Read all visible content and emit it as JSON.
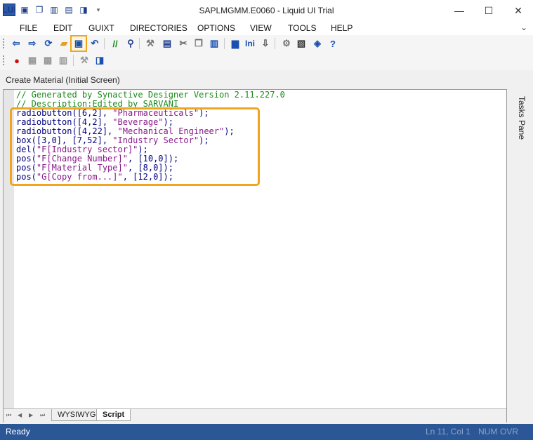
{
  "window": {
    "title": "SAPLMGMM.E0060 - Liquid UI Trial",
    "logo_text": "LUI",
    "controls": {
      "minimize": "—",
      "maximize": "☐",
      "close": "✕"
    }
  },
  "menu": {
    "items": [
      "FILE",
      "EDIT",
      "GUIXT",
      "DIRECTORIES",
      "OPTIONS",
      "VIEW",
      "TOOLS",
      "HELP"
    ],
    "collapse_glyph": "⌄"
  },
  "toolbar": {
    "buttons": [
      {
        "icon": "back-arrow-icon",
        "glyph": "⇦",
        "color": "#1a50b0"
      },
      {
        "icon": "forward-arrow-icon",
        "glyph": "⇨",
        "color": "#1a50b0"
      },
      {
        "icon": "refresh-icon",
        "glyph": "⟳",
        "color": "#1a50b0"
      },
      {
        "icon": "open-folder-icon",
        "glyph": "▰",
        "color": "#e0a020"
      },
      {
        "icon": "save-icon",
        "glyph": "▣",
        "color": "#1a50b0",
        "highlighted": true
      },
      {
        "icon": "undo-icon",
        "glyph": "↶",
        "color": "#1a50b0"
      },
      {
        "icon": "comment-icon",
        "glyph": "//",
        "color": "#1a8a1a"
      },
      {
        "icon": "find-icon",
        "glyph": "⚲",
        "color": "#1a3a8a"
      },
      {
        "icon": "wrench-icon",
        "glyph": "⚒",
        "color": "#777777"
      },
      {
        "icon": "properties-icon",
        "glyph": "▤",
        "color": "#1a3a8a"
      },
      {
        "icon": "cut-icon",
        "glyph": "✂",
        "color": "#666666"
      },
      {
        "icon": "copy-icon",
        "glyph": "❐",
        "color": "#666666"
      },
      {
        "icon": "paste-icon",
        "glyph": "▥",
        "color": "#1a50b0"
      },
      {
        "icon": "print-icon",
        "glyph": "▆",
        "color": "#1a50b0"
      },
      {
        "icon": "ini-icon",
        "label": "Ini",
        "color": "#1a50b0"
      },
      {
        "icon": "download-icon",
        "glyph": "⇩",
        "color": "#555555"
      },
      {
        "icon": "settings-gear-icon",
        "glyph": "⚙",
        "color": "#777777"
      },
      {
        "icon": "screen-icon",
        "glyph": "▧",
        "color": "#333333"
      },
      {
        "icon": "book-icon",
        "glyph": "◈",
        "color": "#1a50b0"
      },
      {
        "icon": "help-icon",
        "glyph": "?",
        "color": "#1a50b0"
      }
    ],
    "row2": [
      {
        "icon": "record-icon",
        "glyph": "●",
        "color": "#d01010"
      },
      {
        "icon": "table-icon",
        "glyph": "▦",
        "color": "#999999"
      },
      {
        "icon": "table-delete-icon",
        "glyph": "▩",
        "color": "#999999"
      },
      {
        "icon": "grid-icon",
        "glyph": "▥",
        "color": "#999999"
      },
      {
        "icon": "tools-icon",
        "glyph": "⚒",
        "color": "#999999"
      },
      {
        "icon": "connect-icon",
        "glyph": "◨",
        "color": "#1a50b0"
      }
    ]
  },
  "screen_label": "Create Material (Initial Screen)",
  "editor": {
    "lines": [
      {
        "kind": "comment",
        "text": "// Generated by Synactive Designer Version 2.11.227.0"
      },
      {
        "kind": "comment",
        "text": "// Description:Edited by SARVANI"
      },
      {
        "kind": "code",
        "fn": "radiobutton(",
        "args": "[6,2], ",
        "str": "\"Pharmaceuticals\"",
        "tail": ");"
      },
      {
        "kind": "code",
        "fn": "radiobutton(",
        "args": "[4,2], ",
        "str": "\"Beverage\"",
        "tail": ");"
      },
      {
        "kind": "code",
        "fn": "radiobutton(",
        "args": "[4,22], ",
        "str": "\"Mechanical Engineer\"",
        "tail": ");"
      },
      {
        "kind": "code",
        "fn": "box(",
        "args": "[3,0], [7,52], ",
        "str": "\"Industry Sector\"",
        "tail": ");"
      },
      {
        "kind": "code",
        "fn": "del(",
        "args": "",
        "str": "\"F[Industry sector]\"",
        "tail": ");"
      },
      {
        "kind": "code",
        "fn": "pos(",
        "args": "",
        "str": "\"F[Change Number]\"",
        "tail": ", [10,0]);"
      },
      {
        "kind": "code",
        "fn": "pos(",
        "args": "",
        "str": "\"F[Material Type]\"",
        "tail": ", [8,0]);"
      },
      {
        "kind": "code",
        "fn": "pos(",
        "args": "",
        "str": "\"G[Copy from...]\"",
        "tail": ", [12,0]);"
      }
    ],
    "tabs": [
      {
        "label": "WYSIWYG",
        "active": false
      },
      {
        "label": "Script",
        "active": true
      }
    ],
    "nav_glyphs": [
      "⏮",
      "◀",
      "▶",
      "⏭"
    ]
  },
  "side_pane": {
    "label": "Tasks Pane"
  },
  "status": {
    "ready": "Ready",
    "position": "Ln 11, Col 1",
    "num": "NUM",
    "ovr": "OVR"
  },
  "colors": {
    "accent": "#2b5797",
    "highlight": "#f0a420"
  }
}
